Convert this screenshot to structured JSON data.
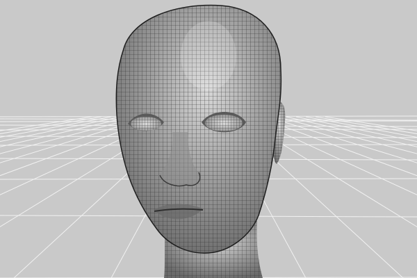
{
  "viewport": {
    "view_type": "perspective",
    "background_color": "#c9c9c9",
    "grid": {
      "visible": true,
      "color": "#f2f2f2"
    },
    "model": {
      "name": "female-head",
      "display_mode": "wireframe-shaded",
      "wire_color": "#2b2b2b",
      "surface_color": "#9a9a9a"
    }
  }
}
